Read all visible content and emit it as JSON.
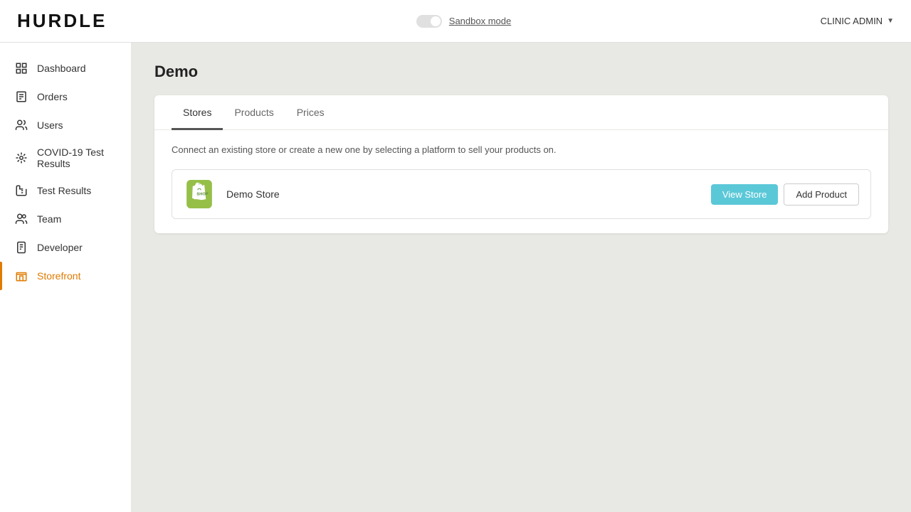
{
  "app": {
    "logo": "HURDLE"
  },
  "header": {
    "sandbox_label": "Sandbox mode",
    "admin_label": "CLINIC ADMIN"
  },
  "sidebar": {
    "items": [
      {
        "id": "dashboard",
        "label": "Dashboard",
        "icon": "dashboard-icon",
        "active": false
      },
      {
        "id": "orders",
        "label": "Orders",
        "icon": "orders-icon",
        "active": false
      },
      {
        "id": "users",
        "label": "Users",
        "icon": "users-icon",
        "active": false
      },
      {
        "id": "covid-results",
        "label": "COVID-19 Test Results",
        "icon": "covid-icon",
        "active": false
      },
      {
        "id": "test-results",
        "label": "Test Results",
        "icon": "test-icon",
        "active": false
      },
      {
        "id": "team",
        "label": "Team",
        "icon": "team-icon",
        "active": false
      },
      {
        "id": "developer",
        "label": "Developer",
        "icon": "developer-icon",
        "active": false
      },
      {
        "id": "storefront",
        "label": "Storefront",
        "icon": "storefront-icon",
        "active": true
      }
    ]
  },
  "main": {
    "page_title": "Demo",
    "tabs": [
      {
        "id": "stores",
        "label": "Stores",
        "active": true
      },
      {
        "id": "products",
        "label": "Products",
        "active": false
      },
      {
        "id": "prices",
        "label": "Prices",
        "active": false
      }
    ],
    "store_description": "Connect an existing store or create a new one by selecting a platform to sell your products on.",
    "store_row": {
      "name": "Demo Store",
      "view_store_label": "View Store",
      "add_product_label": "Add Product"
    }
  }
}
